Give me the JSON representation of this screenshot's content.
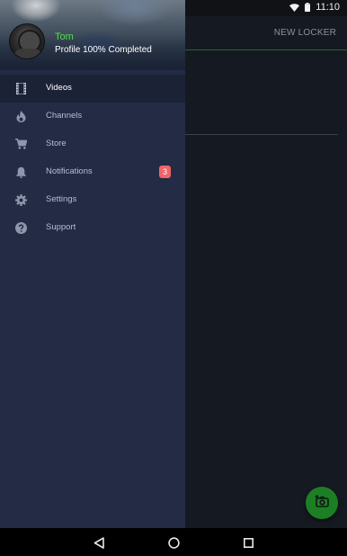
{
  "status_bar": {
    "time": "11:10",
    "icons": [
      "wifi-icon",
      "battery-icon"
    ]
  },
  "app": {
    "toolbar_action": "NEW LOCKER",
    "fab_icon": "camera-add-icon",
    "accent_color": "#1d7f24"
  },
  "drawer": {
    "user": {
      "name": "Tom",
      "progress": "Profile 100% Completed",
      "name_color": "#4ee14a"
    },
    "menu": [
      {
        "label": "Videos",
        "icon": "film-icon",
        "active": true
      },
      {
        "label": "Channels",
        "icon": "flame-icon",
        "active": false
      },
      {
        "label": "Store",
        "icon": "cart-icon",
        "active": false
      },
      {
        "label": "Notifications",
        "icon": "bell-icon",
        "active": false,
        "badge": "3"
      },
      {
        "label": "Settings",
        "icon": "gear-icon",
        "active": false
      },
      {
        "label": "Support",
        "icon": "help-icon",
        "active": false
      }
    ],
    "badge_color": "#f0646a"
  },
  "nav_bar": {
    "buttons": [
      "back-icon",
      "home-icon",
      "recents-icon"
    ]
  }
}
